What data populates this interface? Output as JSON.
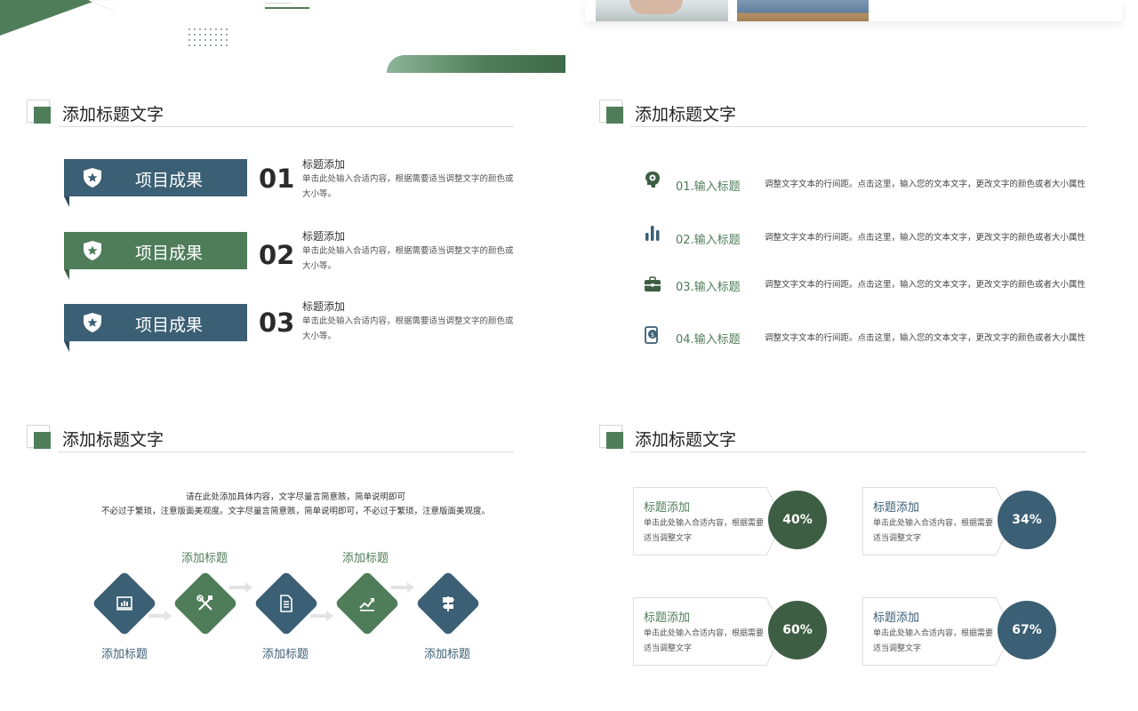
{
  "colors": {
    "green": "#4f7d5a",
    "dark_green": "#3d5e43",
    "blue": "#3b5f74",
    "gray_arrow": "#e3e3e3"
  },
  "q1": {
    "title": "添加标题文字",
    "items": [
      {
        "tag": "项目成果",
        "num": "01",
        "title": "标题添加",
        "desc": "单击此处输入合适内容，根据需要适当调整文字的颜色或大小等。"
      },
      {
        "tag": "项目成果",
        "num": "02",
        "title": "标题添加",
        "desc": "单击此处输入合适内容，根据需要适当调整文字的颜色或大小等。"
      },
      {
        "tag": "项目成果",
        "num": "03",
        "title": "标题添加",
        "desc": "单击此处输入合适内容，根据需要适当调整文字的颜色或大小等。"
      }
    ]
  },
  "q2": {
    "title": "添加标题文字",
    "items": [
      {
        "icon": "brain-icon",
        "label": "01.输入标题",
        "desc": "调整文字文本的行间距。点击这里，输入您的文本文字，更改文字的颜色或者大小属性"
      },
      {
        "icon": "bar-chart-icon",
        "label": "02.输入标题",
        "desc": "调整文字文本的行间距。点击这里，输入您的文本文字，更改文字的颜色或者大小属性"
      },
      {
        "icon": "briefcase-icon",
        "label": "03.输入标题",
        "desc": "调整文字文本的行间距。点击这里，输入您的文本文字，更改文字的颜色或者大小属性"
      },
      {
        "icon": "money-phone-icon",
        "label": "04.输入标题",
        "desc": "调整文字文本的行间距。点击这里，输入您的文本文字，更改文字的颜色或者大小属性"
      }
    ]
  },
  "q3": {
    "title": "添加标题文字",
    "intro_line1": "请在此处添加具体内容，文字尽量言简意赅，简单说明即可",
    "intro_line2": "不必过于繁琐，注意版面美观度。文字尽量言简意赅，简单说明即可，不必过于繁琐，注意版面美观度。",
    "steps": [
      {
        "icon": "chart-board-icon",
        "label": "添加标题",
        "label_pos": "bottom"
      },
      {
        "icon": "tools-icon",
        "label": "添加标题",
        "label_pos": "top"
      },
      {
        "icon": "document-icon",
        "label": "添加标题",
        "label_pos": "bottom"
      },
      {
        "icon": "growth-chart-icon",
        "label": "添加标题",
        "label_pos": "top"
      },
      {
        "icon": "signpost-icon",
        "label": "添加标题",
        "label_pos": "bottom"
      }
    ]
  },
  "q4": {
    "title": "添加标题文字",
    "cards": [
      {
        "title": "标题添加",
        "desc": "单击此处输入合适内容，根据需要适当调整文字",
        "percent": "40%"
      },
      {
        "title": "标题添加",
        "desc": "单击此处输入合适内容，根据需要适当调整文字",
        "percent": "34%"
      },
      {
        "title": "标题添加",
        "desc": "单击此处输入合适内容，根据需要适当调整文字",
        "percent": "60%"
      },
      {
        "title": "标题添加",
        "desc": "单击此处输入合适内容，根据需要适当调整文字",
        "percent": "67%"
      }
    ]
  }
}
